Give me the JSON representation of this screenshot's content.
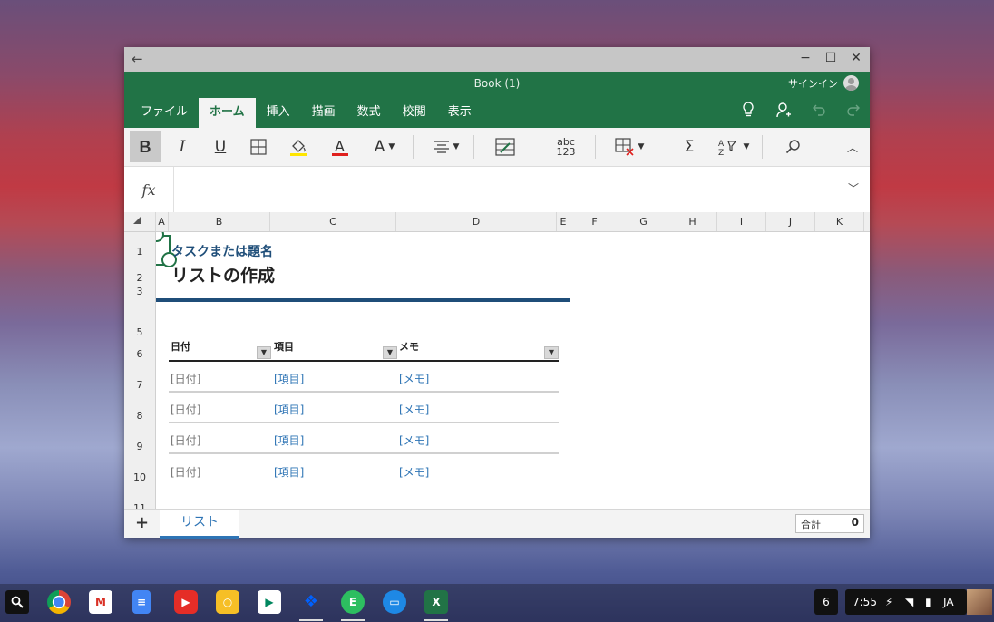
{
  "window": {
    "back_icon": "←",
    "minimize_icon": "−",
    "maximize_icon": "☐",
    "close_icon": "✕"
  },
  "ribbon": {
    "book_title": "Book (1)",
    "signin_label": "サインイン",
    "tabs": [
      {
        "label": "ファイル",
        "active": false
      },
      {
        "label": "ホーム",
        "active": true
      },
      {
        "label": "挿入",
        "active": false
      },
      {
        "label": "描画",
        "active": false
      },
      {
        "label": "数式",
        "active": false
      },
      {
        "label": "校閲",
        "active": false
      },
      {
        "label": "表示",
        "active": false
      }
    ],
    "bold": "B",
    "italic": "I",
    "underline": "U",
    "font_color": "A",
    "font_size": "A",
    "spell_top": "abc",
    "spell_bottom": "123",
    "sum": "Σ",
    "sort": "A↓Z"
  },
  "formula_bar": {
    "fx_label": "fx",
    "value": ""
  },
  "grid": {
    "columns": [
      "A",
      "B",
      "C",
      "D",
      "E",
      "F",
      "G",
      "H",
      "I",
      "J",
      "K"
    ],
    "rows": [
      "1",
      "2",
      "3",
      "5",
      "6",
      "7",
      "8",
      "9",
      "10",
      "11"
    ]
  },
  "sheet": {
    "subtitle": "タスクまたは題名",
    "title": "リストの作成",
    "headers": [
      "日付",
      "項目",
      "メモ"
    ],
    "rows": [
      {
        "date": "[日付]",
        "item": "[項目]",
        "memo": "[メモ]"
      },
      {
        "date": "[日付]",
        "item": "[項目]",
        "memo": "[メモ]"
      },
      {
        "date": "[日付]",
        "item": "[項目]",
        "memo": "[メモ]"
      },
      {
        "date": "[日付]",
        "item": "[項目]",
        "memo": "[メモ]"
      }
    ]
  },
  "bottom": {
    "add_sheet": "+",
    "sheet_tab": "リスト",
    "sum_label": "合計",
    "sum_value": "0"
  },
  "shelf": {
    "notification_count": "6",
    "time": "7:55",
    "ime": "JA"
  },
  "colors": {
    "excel_green": "#217346",
    "title_blue": "#1f4e79",
    "link_blue": "#2e74b5"
  }
}
